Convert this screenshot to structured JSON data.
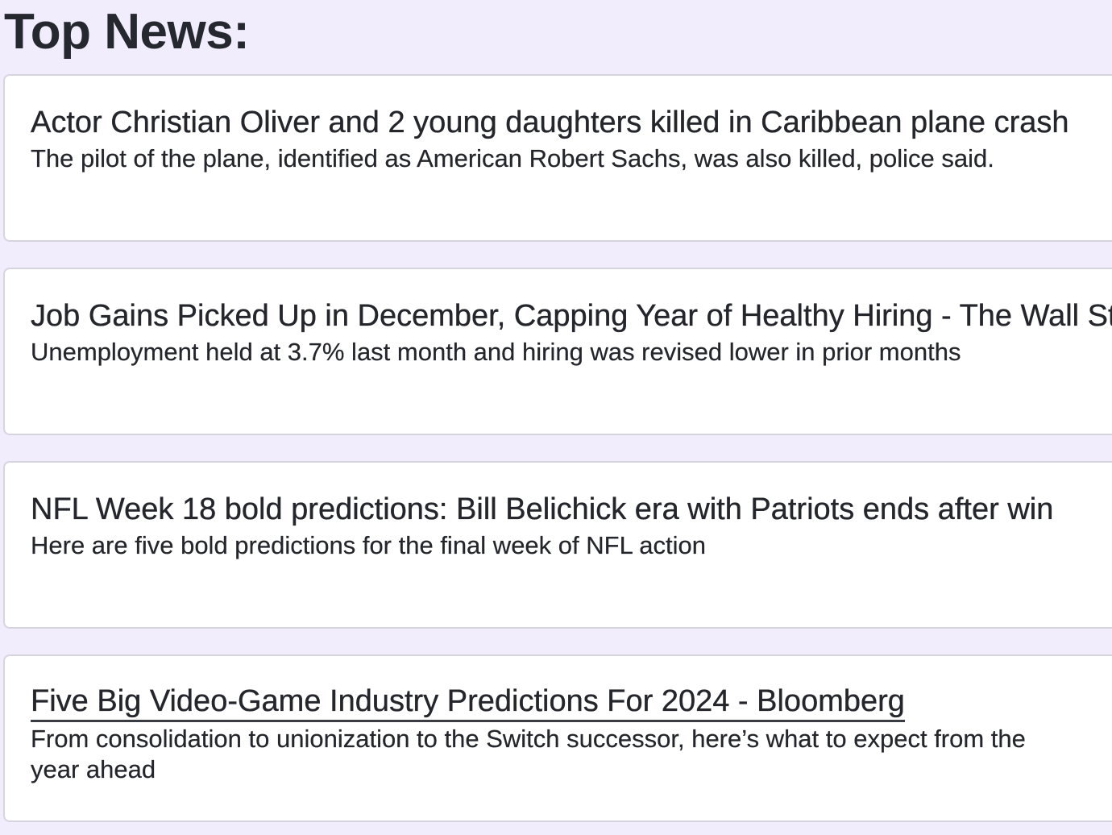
{
  "page": {
    "title": "Top News:",
    "background_color": "#f1edfd",
    "card_color": "#ffffff",
    "text_color": "#24262b"
  },
  "news": [
    {
      "headline": "Actor Christian Oliver and 2 young daughters killed in Caribbean plane crash",
      "summary": "The pilot of the plane, identified as American Robert Sachs, was also killed, police said."
    },
    {
      "headline": "Job Gains Picked Up in December, Capping Year of Healthy Hiring - The Wall Street Journal",
      "summary": "Unemployment held at 3.7% last month and hiring was revised lower in prior months"
    },
    {
      "headline": "NFL Week 18 bold predictions: Bill Belichick era with Patriots ends after win",
      "summary": "Here are five bold predictions for the final week of NFL action"
    },
    {
      "headline": "Five Big Video-Game Industry Predictions For 2024 - Bloomberg",
      "summary": "From consolidation to unionization to the Switch successor, here’s what to expect from the year ahead"
    }
  ]
}
